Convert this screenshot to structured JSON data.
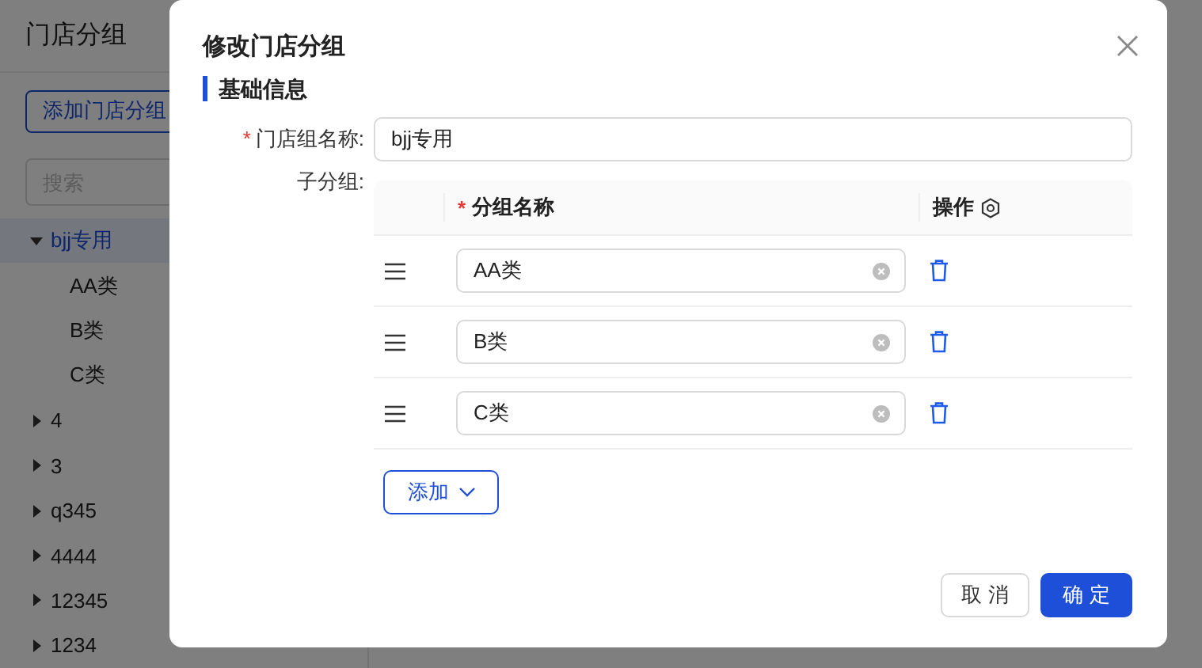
{
  "page": {
    "title": "门店分组",
    "add_button": "添加门店分组",
    "search": {
      "placeholder": "搜索"
    },
    "tree": [
      {
        "label": "bjj专用",
        "expanded": true,
        "selected": true,
        "children": [
          {
            "label": "AA类",
            "selected": false
          },
          {
            "label": "B类",
            "selected": false
          },
          {
            "label": "C类",
            "selected": false
          }
        ]
      },
      {
        "label": "4",
        "expanded": false,
        "selected": false
      },
      {
        "label": "3",
        "expanded": false,
        "selected": false
      },
      {
        "label": "q345",
        "expanded": false,
        "selected": false
      },
      {
        "label": "4444",
        "expanded": false,
        "selected": false
      },
      {
        "label": "12345",
        "expanded": false,
        "selected": false
      },
      {
        "label": "1234",
        "expanded": false,
        "selected": false
      }
    ]
  },
  "modal": {
    "title": "修改门店分组",
    "section": "基础信息",
    "name_field": {
      "required_mark": "*",
      "label": "门店组名称:",
      "value": "bjj专用"
    },
    "subgroups": {
      "label": "子分组:",
      "columns": [
        {
          "required_mark": "*",
          "title": "分组名称"
        },
        {
          "title": "操作"
        }
      ],
      "rows": [
        {
          "value": "AA类"
        },
        {
          "value": "B类"
        },
        {
          "value": "C类"
        }
      ],
      "add_button": "添加"
    },
    "buttons": [
      {
        "label": "取 消",
        "kind": "default"
      },
      {
        "label": "确 定",
        "kind": "primary"
      }
    ]
  }
}
